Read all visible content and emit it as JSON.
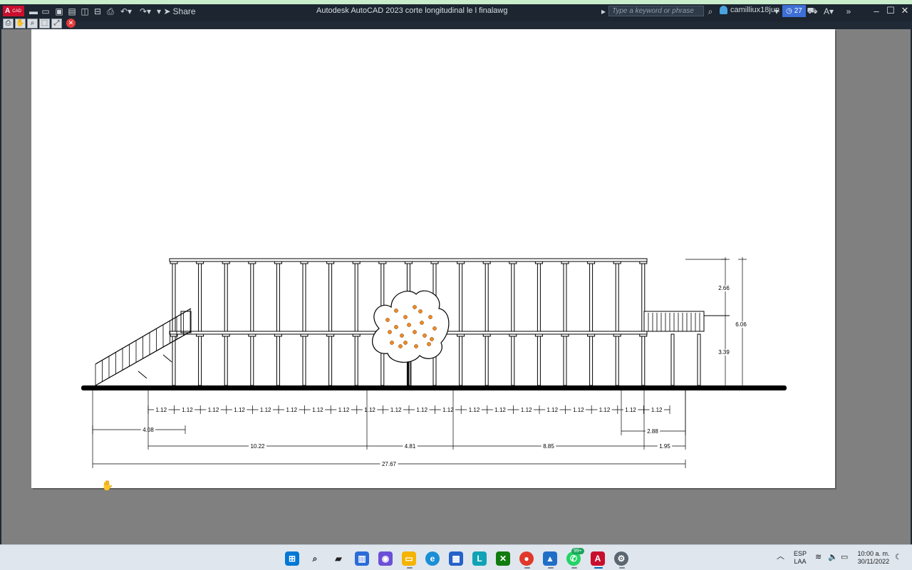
{
  "titlebar": {
    "app_logo": "A",
    "app_logo_sub": "CAD",
    "title": "Autodesk AutoCAD 2023    corte longitudinal le l finalawg",
    "share_label": "Share",
    "search_placeholder": "Type a keyword or phrase",
    "user_name": "camilliux18jun",
    "timer_label": "27"
  },
  "drawing": {
    "dimensions": {
      "segments": [
        "1.12",
        "1.12",
        "1.12",
        "1.12",
        "1.12",
        "1.12",
        "1.12",
        "1.12",
        "1.12",
        "1.12",
        "1.12",
        "1.12",
        "1.12",
        "1.12",
        "1.12",
        "1.12",
        "1.12",
        "1.12",
        "1.12",
        "1.12"
      ],
      "stair_width": "4.08",
      "right_seg": "2.88",
      "left_span": "10.22",
      "mid_span": "4.81",
      "right_span": "8.85",
      "end_span": "1.95",
      "total": "27.67",
      "upper_height": "2.66",
      "total_height": "6.06",
      "lower_height": "3.39"
    }
  },
  "taskbar": {
    "whatsapp_badge": "99+",
    "lang_top": "ESP",
    "lang_bottom": "LAA",
    "time": "10:00 a. m.",
    "date": "30/11/2022"
  },
  "colors": {
    "titlebar_bg": "#1c2530",
    "workspace_bg": "#808080",
    "sheet_bg": "#ffffff",
    "accent_blue": "#3d6fd6",
    "autocad_red": "#c8102e",
    "tree_fruit": "#f08a24"
  }
}
